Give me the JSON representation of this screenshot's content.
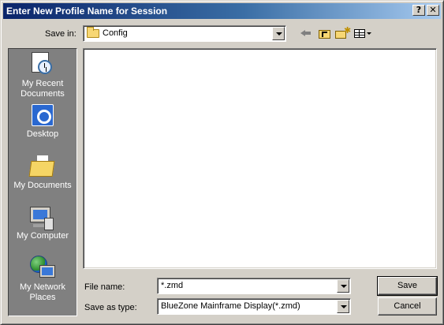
{
  "window": {
    "title": "Enter New Profile Name for Session",
    "help_glyph": "?",
    "close_glyph": "✕"
  },
  "save_in": {
    "label": "Save in:",
    "value": "Config"
  },
  "toolbar": {
    "icons": [
      "back-arrow-icon",
      "up-one-level-icon",
      "create-new-folder-icon",
      "view-menu-icon"
    ]
  },
  "places": [
    {
      "label_line1": "My Recent",
      "label_line2": "Documents",
      "icon": "recent-documents-icon"
    },
    {
      "label_line1": "Desktop",
      "label_line2": "",
      "icon": "desktop-icon"
    },
    {
      "label_line1": "My Documents",
      "label_line2": "",
      "icon": "my-documents-icon"
    },
    {
      "label_line1": "My Computer",
      "label_line2": "",
      "icon": "my-computer-icon"
    },
    {
      "label_line1": "My Network",
      "label_line2": "Places",
      "icon": "network-places-icon"
    }
  ],
  "file_name": {
    "label": "File name:",
    "value": "*.zmd"
  },
  "save_as_type": {
    "label": "Save as type:",
    "value": "BlueZone Mainframe Display(*.zmd)"
  },
  "buttons": {
    "save": "Save",
    "cancel": "Cancel"
  },
  "colors": {
    "title_gradient_start": "#0a246a",
    "title_gradient_end": "#a6caf0",
    "face": "#d4d0c8",
    "places_bar": "#808080"
  }
}
